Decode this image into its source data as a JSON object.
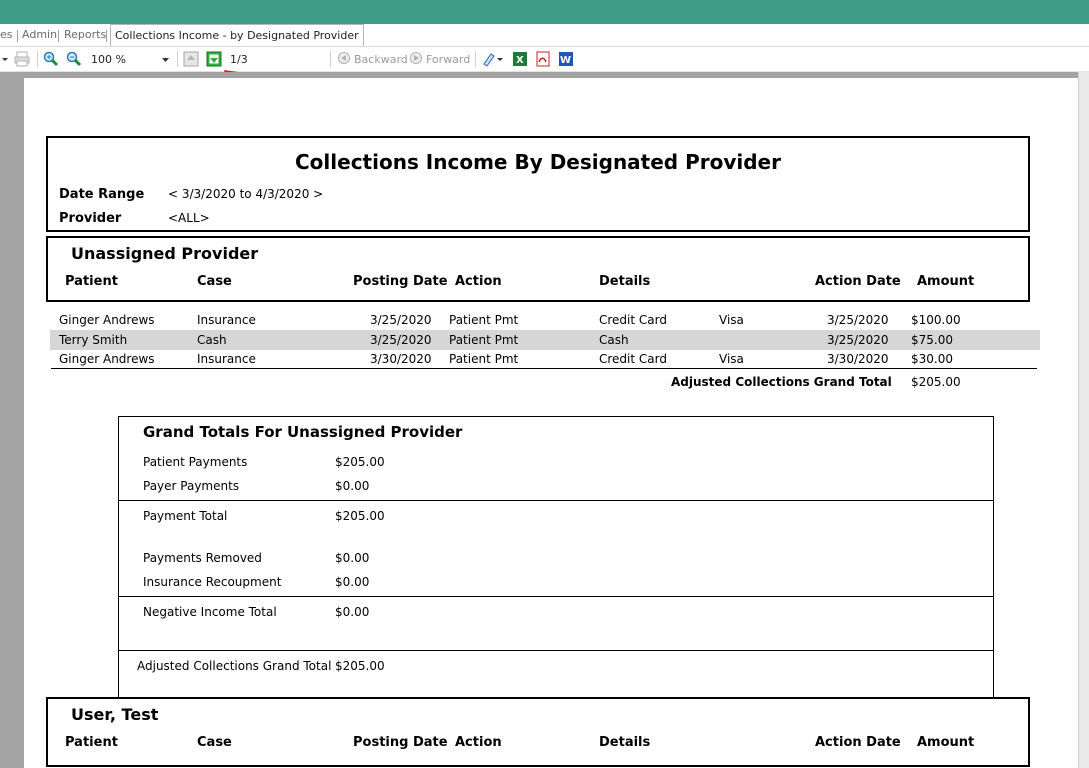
{
  "tabs": [
    "es",
    "Admin",
    "Reports",
    "Collections Income - by Designated Provider"
  ],
  "toolbar": {
    "zoom": "100 %",
    "page_indicator": "1/3",
    "backward_label": "Backward",
    "forward_label": "Forward"
  },
  "report": {
    "title": "Collections Income By Designated Provider",
    "date_range_label": "Date Range",
    "date_range_value": "< 3/3/2020 to 4/3/2020 >",
    "provider_label": "Provider",
    "provider_value": "<ALL>",
    "columns": [
      "Patient",
      "Case",
      "Posting Date",
      "Action",
      "Details",
      "Action Date",
      "Amount"
    ],
    "group1": {
      "name": "Unassigned Provider",
      "rows": [
        {
          "patient": "Ginger Andrews",
          "case": "Insurance",
          "posting_date": "3/25/2020",
          "action": "Patient Pmt",
          "details": "Credit Card",
          "details2": "Visa",
          "action_date": "3/25/2020",
          "amount": "$100.00"
        },
        {
          "patient": "Terry Smith",
          "case": "Cash",
          "posting_date": "3/25/2020",
          "action": "Patient Pmt",
          "details": "Cash",
          "details2": "",
          "action_date": "3/25/2020",
          "amount": "$75.00"
        },
        {
          "patient": "Ginger Andrews",
          "case": "Insurance",
          "posting_date": "3/30/2020",
          "action": "Patient Pmt",
          "details": "Credit Card",
          "details2": "Visa",
          "action_date": "3/30/2020",
          "amount": "$30.00"
        }
      ],
      "grand_total_label": "Adjusted Collections Grand Total",
      "grand_total_value": "$205.00"
    },
    "grand_totals": {
      "heading_prefix": "Grand Totals For",
      "heading_name": "Unassigned Provider",
      "patient_payments_label": "Patient Payments",
      "patient_payments": "$205.00",
      "payer_payments_label": "Payer Payments",
      "payer_payments": "$0.00",
      "payment_total_label": "Payment Total",
      "payment_total": "$205.00",
      "payments_removed_label": "Payments Removed",
      "payments_removed": "$0.00",
      "insurance_recoupment_label": "Insurance Recoupment",
      "insurance_recoupment": "$0.00",
      "negative_income_label": "Negative Income Total",
      "negative_income": "$0.00",
      "adjusted_label": "Adjusted Collections Grand Total",
      "adjusted": "$205.00"
    },
    "group2": {
      "name": "User, Test"
    }
  },
  "colors": {
    "titlebar": "#3f9e8a",
    "viewer_bg": "#a3a3a3",
    "row_alt": "#d6d6d6",
    "arrow": "#e8161b"
  },
  "icons": [
    "zoom-in-icon",
    "zoom-out-icon",
    "first-page-icon",
    "next-page-icon",
    "backward-icon",
    "forward-icon",
    "highlight-icon",
    "excel-export-icon",
    "pdf-export-icon",
    "word-export-icon",
    "red-arrow-annotation"
  ]
}
